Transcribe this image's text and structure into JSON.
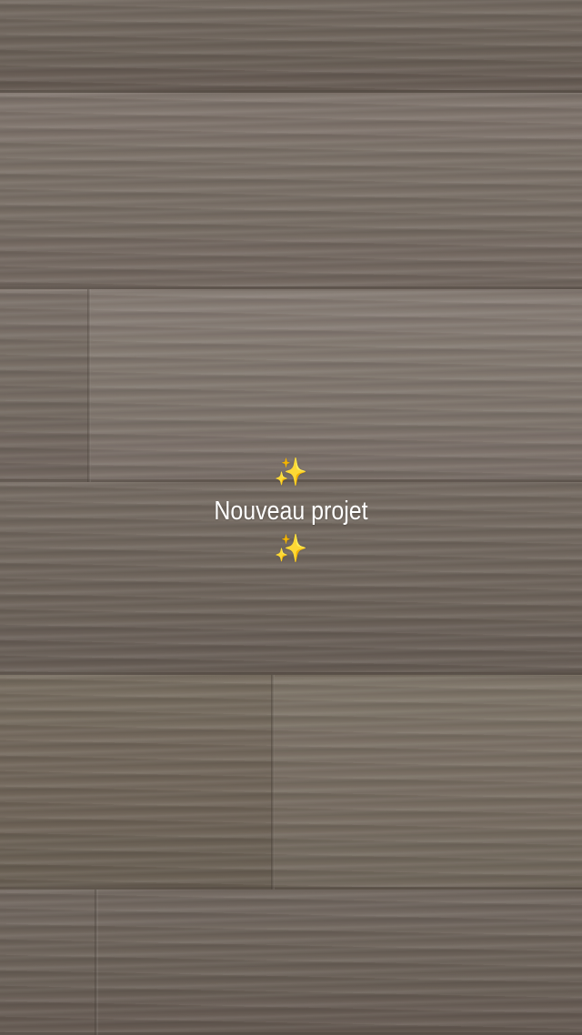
{
  "overlay": {
    "sparkle_top": "✨",
    "title": "Nouveau projet",
    "sparkle_bottom": "✨"
  },
  "background": {
    "description_icon": "wood-floor-texture",
    "colors": {
      "wood_dark": "#6d6259",
      "wood_light": "#7c7168",
      "text": "#ffffff",
      "sparkle": "#f8c94a"
    }
  }
}
